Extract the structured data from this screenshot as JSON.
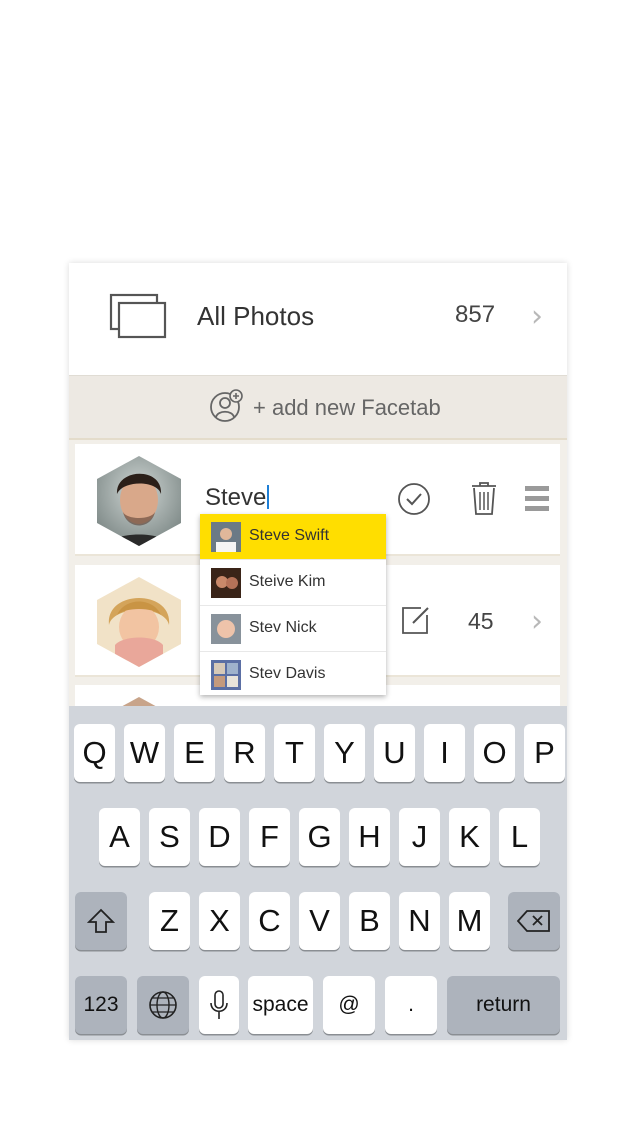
{
  "all_photos": {
    "label": "All Photos",
    "count": "857",
    "icon": "photos-stack-icon"
  },
  "add_facetab": {
    "label": "+ add new Facetab",
    "icon": "add-person-icon"
  },
  "editing_card": {
    "name_value": "Steve"
  },
  "second_card": {
    "count": "45"
  },
  "suggestions": [
    {
      "name": "Steve Swift",
      "highlighted": true
    },
    {
      "name": "Steive Kim",
      "highlighted": false
    },
    {
      "name": "Stev Nick",
      "highlighted": false
    },
    {
      "name": "Stev Davis",
      "highlighted": false
    }
  ],
  "keyboard": {
    "row1": [
      "Q",
      "W",
      "E",
      "R",
      "T",
      "Y",
      "U",
      "I",
      "O",
      "P"
    ],
    "row2": [
      "A",
      "S",
      "D",
      "F",
      "G",
      "H",
      "J",
      "K",
      "L"
    ],
    "row3": [
      "Z",
      "X",
      "C",
      "V",
      "B",
      "N",
      "M"
    ],
    "numbers": "123",
    "space": "space",
    "at": "@",
    "period": ".",
    "return": "return"
  },
  "colors": {
    "highlight": "#ffde00",
    "caret": "#1e7fd6",
    "keyboard_bg": "#d1d5db"
  }
}
